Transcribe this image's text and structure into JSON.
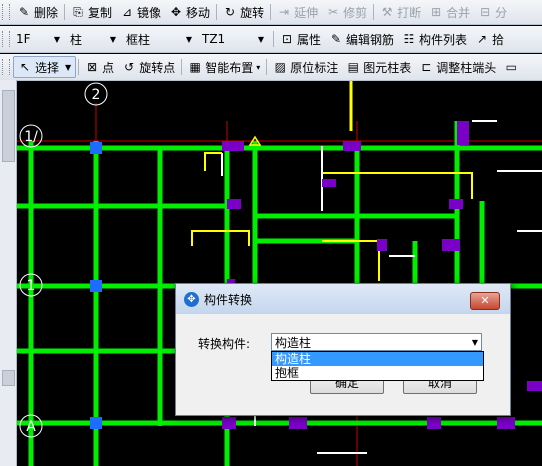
{
  "toolbar1": {
    "items": [
      {
        "icon": "✎",
        "label": "删除",
        "disabled": false
      },
      {
        "icon": "⎘",
        "label": "复制",
        "disabled": false
      },
      {
        "icon": "⊿",
        "label": "镜像",
        "disabled": false
      },
      {
        "icon": "✥",
        "label": "移动",
        "disabled": false
      },
      {
        "icon": "↻",
        "label": "旋转",
        "disabled": false
      },
      {
        "icon": "⇥",
        "label": "延伸",
        "disabled": true
      },
      {
        "icon": "✂",
        "label": "修剪",
        "disabled": true
      },
      {
        "icon": "⚒",
        "label": "打断",
        "disabled": true
      },
      {
        "icon": "⊞",
        "label": "合并",
        "disabled": true
      },
      {
        "icon": "⊟",
        "label": "分",
        "disabled": true
      }
    ]
  },
  "toolbar2": {
    "floor": "1F",
    "category": "柱",
    "type": "框柱",
    "component": "TZ1",
    "buttons": [
      {
        "icon": "⊡",
        "label": "属性"
      },
      {
        "icon": "✎",
        "label": "编辑钢筋"
      },
      {
        "icon": "☷",
        "label": "构件列表"
      },
      {
        "icon": "↗",
        "label": "拾"
      }
    ]
  },
  "toolbar3": {
    "select_label": "选择",
    "buttons": [
      {
        "icon": "⊠",
        "label": "点"
      },
      {
        "icon": "↺",
        "label": "旋转点"
      },
      {
        "icon": "▦",
        "label": "智能布置",
        "dropdown": true
      },
      {
        "icon": "▨",
        "label": "原位标注"
      },
      {
        "icon": "▤",
        "label": "图元柱表"
      },
      {
        "icon": "⊏",
        "label": "调整柱端头"
      },
      {
        "icon": "▭",
        "label": ""
      }
    ]
  },
  "canvas": {
    "axis_labels": [
      "2",
      "1/",
      "1",
      "A"
    ],
    "colors": {
      "beam": "#00ee00",
      "column": "#7a00c8",
      "yellow": "#ffff00",
      "grid": "#ff0000",
      "white": "#ffffff",
      "blue": "#1e6cff"
    }
  },
  "dialog": {
    "title": "构件转换",
    "field_label": "转换构件:",
    "selected_value": "构造柱",
    "options": [
      "构造柱",
      "抱框"
    ],
    "ok_label": "确定",
    "cancel_label": "取消"
  }
}
